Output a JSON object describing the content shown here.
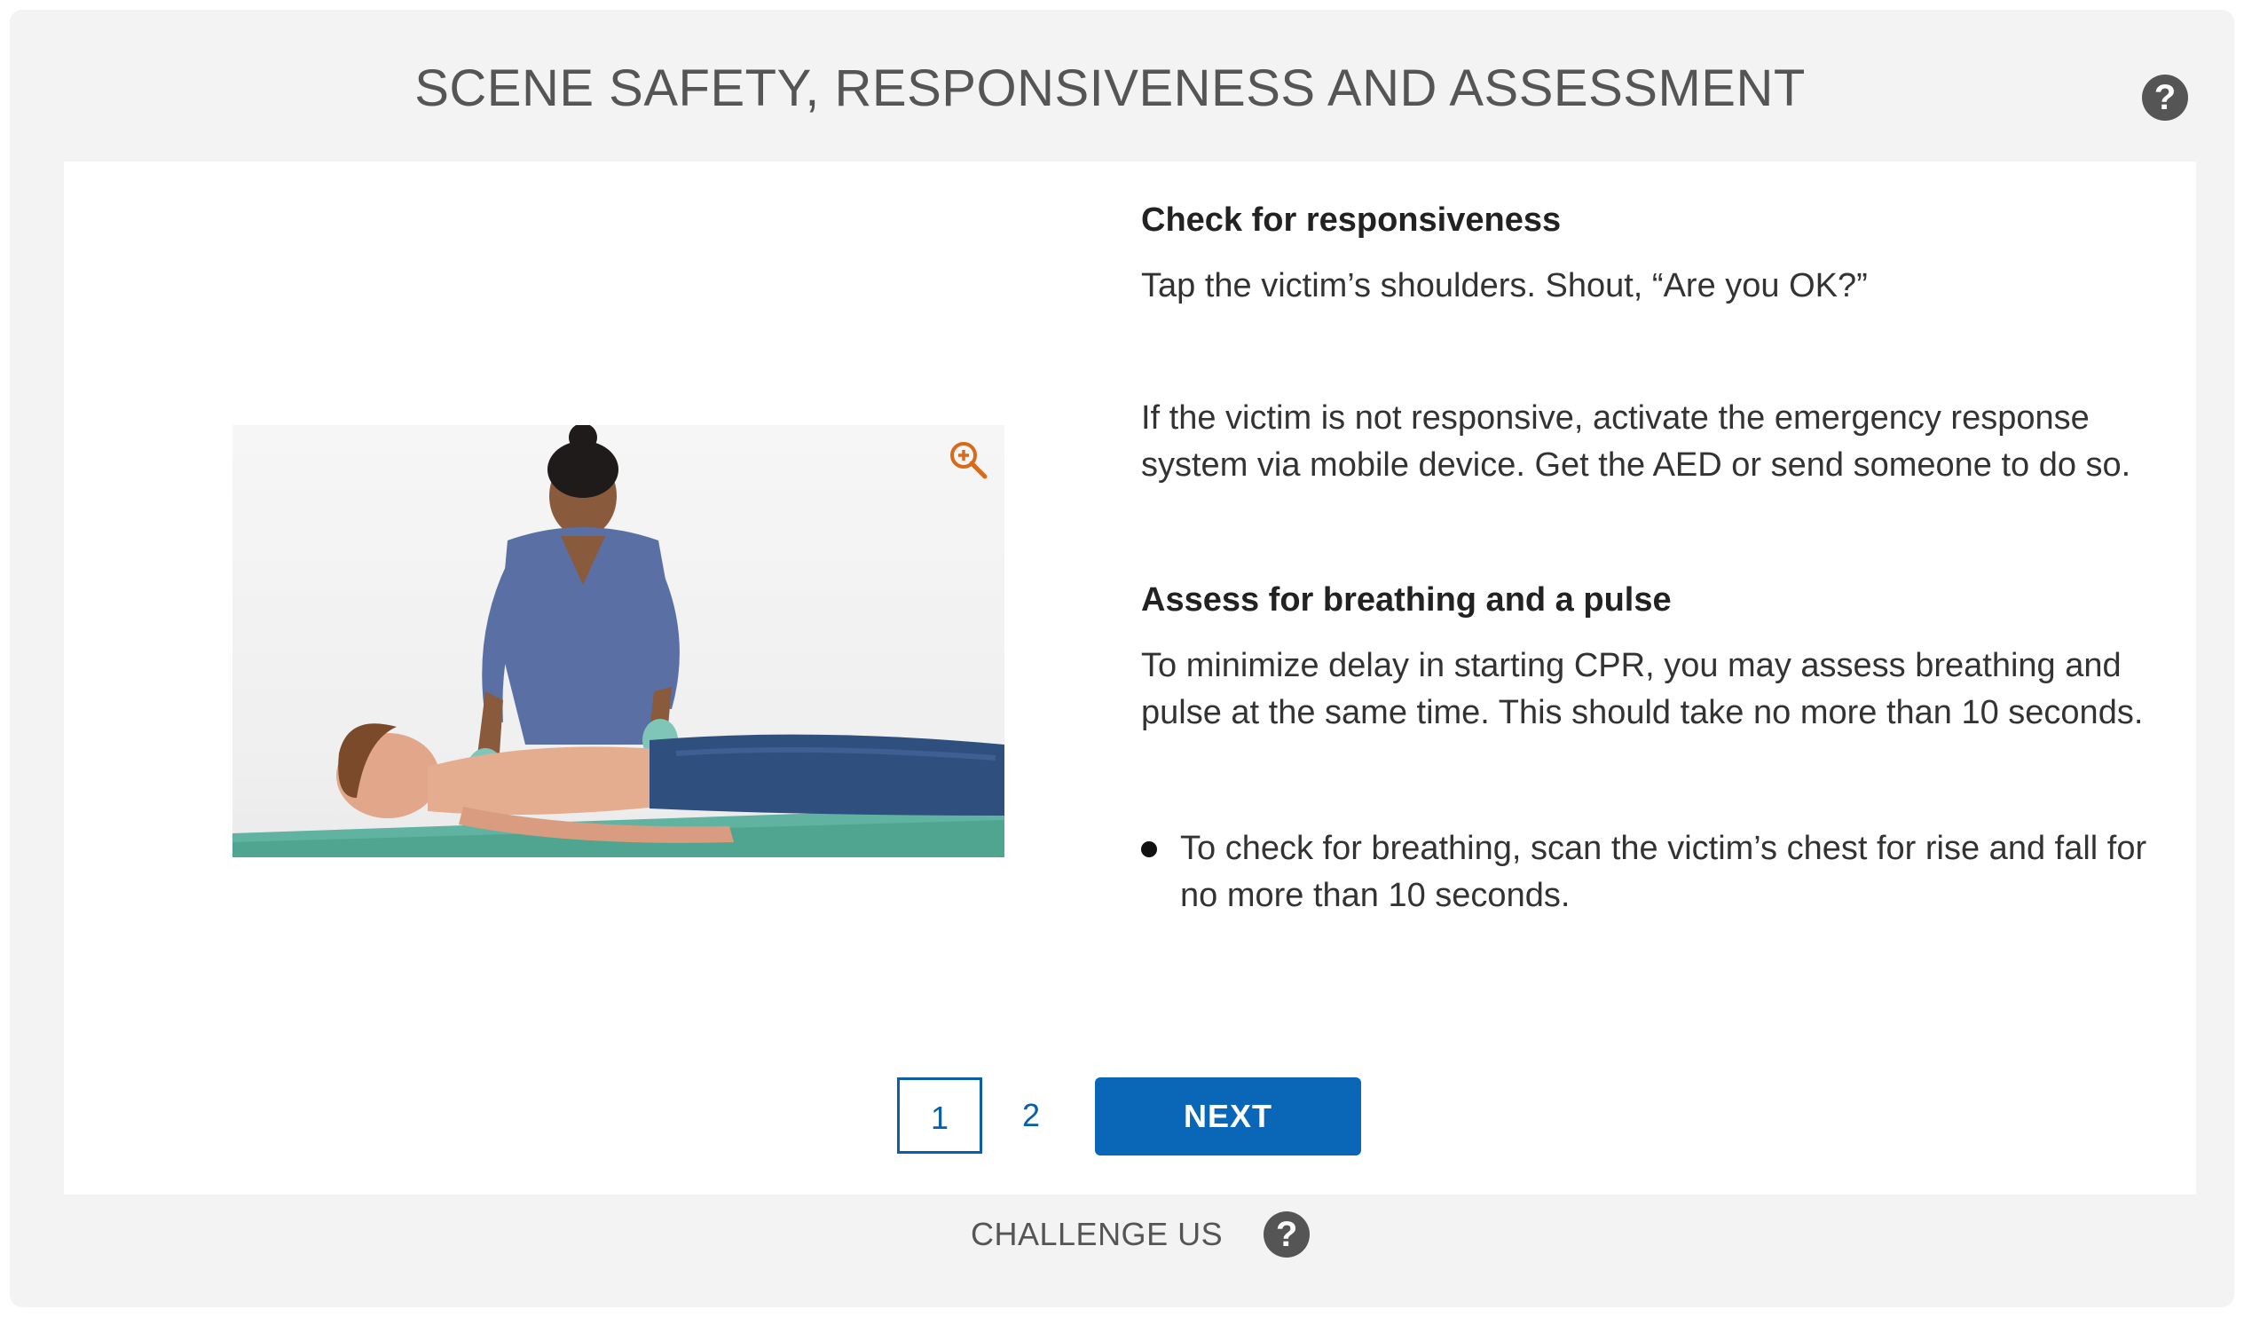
{
  "header": {
    "title": "SCENE SAFETY, RESPONSIVENESS AND ASSESSMENT",
    "help_icon": "question-circle-icon"
  },
  "image": {
    "description_icon": "zoom-in-icon",
    "accent_color": "#d86a1a"
  },
  "content": {
    "section1_heading": "Check for responsiveness",
    "section1_para1": "Tap the victim’s shoulders. Shout, “Are you OK?”",
    "section1_para2": "If the victim is not responsive, activate the emergency response system via mobile device. Get the AED or send someone to do so.",
    "section2_heading": "Assess for breathing and a pulse",
    "section2_para1": "To minimize delay in starting CPR, you may assess breathing and pulse at the same time. This should take no more than 10 seconds.",
    "bullet1": "To check for breathing, scan the victim’s chest for rise and fall for no more than 10 seconds."
  },
  "pagination": {
    "pages": [
      "1",
      "2"
    ],
    "current": "1",
    "next_label": "NEXT",
    "accent_color": "#0a67b8"
  },
  "footer": {
    "challenge_label": "CHALLENGE US",
    "help_icon": "question-circle-icon"
  }
}
